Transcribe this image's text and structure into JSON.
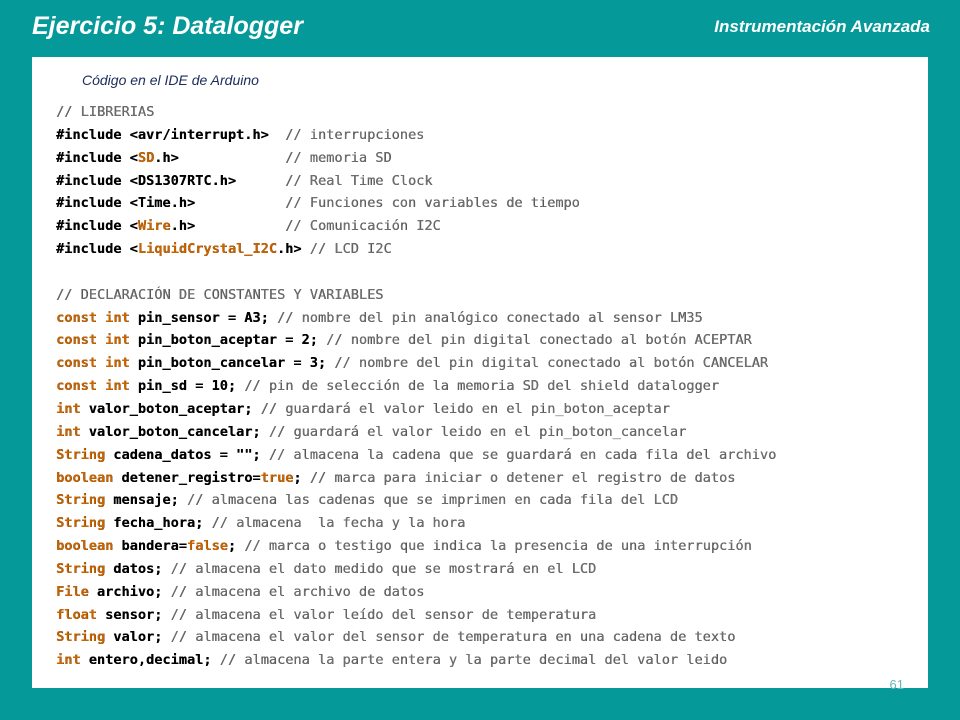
{
  "header": {
    "title": "Ejercicio 5: Datalogger",
    "subject": "Instrumentación Avanzada"
  },
  "content": {
    "caption": "Código  en el IDE de Arduino",
    "page_number": "61"
  },
  "code": {
    "lines": [
      [
        {
          "t": "// LIBRERIAS",
          "c": "cm"
        }
      ],
      [
        {
          "t": "#include <avr/interrupt.h>  "
        },
        {
          "t": "// interrupciones",
          "c": "cm"
        }
      ],
      [
        {
          "t": "#include <"
        },
        {
          "t": "SD",
          "c": "lib"
        },
        {
          "t": ".h>             "
        },
        {
          "t": "// memoria SD",
          "c": "cm"
        }
      ],
      [
        {
          "t": "#include <DS1307RTC.h>      "
        },
        {
          "t": "// Real Time Clock",
          "c": "cm"
        }
      ],
      [
        {
          "t": "#include <Time.h>           "
        },
        {
          "t": "// Funciones con variables de tiempo",
          "c": "cm"
        }
      ],
      [
        {
          "t": "#include <"
        },
        {
          "t": "Wire",
          "c": "lib"
        },
        {
          "t": ".h>           "
        },
        {
          "t": "// Comunicación I2C",
          "c": "cm"
        }
      ],
      [
        {
          "t": "#include <"
        },
        {
          "t": "LiquidCrystal_I2C",
          "c": "lib"
        },
        {
          "t": ".h> "
        },
        {
          "t": "// LCD I2C",
          "c": "cm"
        }
      ],
      [
        {
          "t": ""
        }
      ],
      [
        {
          "t": "// DECLARACIÓN DE CONSTANTES Y VARIABLES",
          "c": "cm"
        }
      ],
      [
        {
          "t": "const int",
          "c": "kw"
        },
        {
          "t": " pin_sensor = A3; "
        },
        {
          "t": "// nombre del pin analógico conectado al sensor LM35",
          "c": "cm"
        }
      ],
      [
        {
          "t": "const int",
          "c": "kw"
        },
        {
          "t": " pin_boton_aceptar = 2; "
        },
        {
          "t": "// nombre del pin digital conectado al botón ACEPTAR",
          "c": "cm"
        }
      ],
      [
        {
          "t": "const int",
          "c": "kw"
        },
        {
          "t": " pin_boton_cancelar = 3; "
        },
        {
          "t": "// nombre del pin digital conectado al botón CANCELAR",
          "c": "cm"
        }
      ],
      [
        {
          "t": "const int",
          "c": "kw"
        },
        {
          "t": " pin_sd = 10; "
        },
        {
          "t": "// pin de selección de la memoria SD del shield datalogger",
          "c": "cm"
        }
      ],
      [
        {
          "t": "int",
          "c": "kw"
        },
        {
          "t": " valor_boton_aceptar; "
        },
        {
          "t": "// guardará el valor leido en el pin_boton_aceptar",
          "c": "cm"
        }
      ],
      [
        {
          "t": "int",
          "c": "kw"
        },
        {
          "t": " valor_boton_cancelar; "
        },
        {
          "t": "// guardará el valor leido en el pin_boton_cancelar",
          "c": "cm"
        }
      ],
      [
        {
          "t": "String",
          "c": "kw"
        },
        {
          "t": " cadena_datos = \"\"; "
        },
        {
          "t": "// almacena la cadena que se guardará en cada fila del archivo",
          "c": "cm"
        }
      ],
      [
        {
          "t": "boolean",
          "c": "kw"
        },
        {
          "t": " detener_registro="
        },
        {
          "t": "true",
          "c": "kw"
        },
        {
          "t": "; "
        },
        {
          "t": "// marca para iniciar o detener el registro de datos",
          "c": "cm"
        }
      ],
      [
        {
          "t": "String",
          "c": "kw"
        },
        {
          "t": " mensaje; "
        },
        {
          "t": "// almacena las cadenas que se imprimen en cada fila del LCD",
          "c": "cm"
        }
      ],
      [
        {
          "t": "String",
          "c": "kw"
        },
        {
          "t": " fecha_hora; "
        },
        {
          "t": "// almacena  la fecha y la hora",
          "c": "cm"
        }
      ],
      [
        {
          "t": "boolean",
          "c": "kw"
        },
        {
          "t": " bandera="
        },
        {
          "t": "false",
          "c": "kw"
        },
        {
          "t": "; "
        },
        {
          "t": "// marca o testigo que indica la presencia de una interrupción",
          "c": "cm"
        }
      ],
      [
        {
          "t": "String",
          "c": "kw"
        },
        {
          "t": " datos; "
        },
        {
          "t": "// almacena el dato medido que se mostrará en el LCD",
          "c": "cm"
        }
      ],
      [
        {
          "t": "File",
          "c": "kw"
        },
        {
          "t": " archivo; "
        },
        {
          "t": "// almacena el archivo de datos",
          "c": "cm"
        }
      ],
      [
        {
          "t": "float",
          "c": "kw"
        },
        {
          "t": " sensor; "
        },
        {
          "t": "// almacena el valor leído del sensor de temperatura",
          "c": "cm"
        }
      ],
      [
        {
          "t": "String",
          "c": "kw"
        },
        {
          "t": " valor; "
        },
        {
          "t": "// almacena el valor del sensor de temperatura en una cadena de texto",
          "c": "cm"
        }
      ],
      [
        {
          "t": "int",
          "c": "kw"
        },
        {
          "t": " entero,decimal; "
        },
        {
          "t": "// almacena la parte entera y la parte decimal del valor leido",
          "c": "cm"
        }
      ]
    ]
  }
}
